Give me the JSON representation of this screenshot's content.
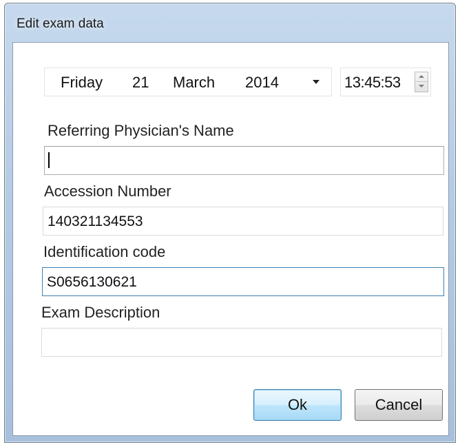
{
  "window": {
    "title": "Edit exam data"
  },
  "datetime": {
    "weekday": "Friday",
    "day": "21",
    "month": "March",
    "year": "2014",
    "time": "13:45:53",
    "dropdown_icon": "chevron-down-icon",
    "spinner_icon": "spin-up-down-icon"
  },
  "form": {
    "referring_physician": {
      "label": "Referring Physician's Name",
      "value": ""
    },
    "accession_number": {
      "label": "Accession Number",
      "value": "140321134553"
    },
    "identification_code": {
      "label": "Identification code",
      "value": "S0656130621"
    },
    "exam_description": {
      "label": "Exam Description",
      "value": ""
    }
  },
  "buttons": {
    "ok": "Ok",
    "cancel": "Cancel"
  },
  "colors": {
    "title_bar": "#b4cbe4",
    "focus_border": "#3c7fb1"
  }
}
